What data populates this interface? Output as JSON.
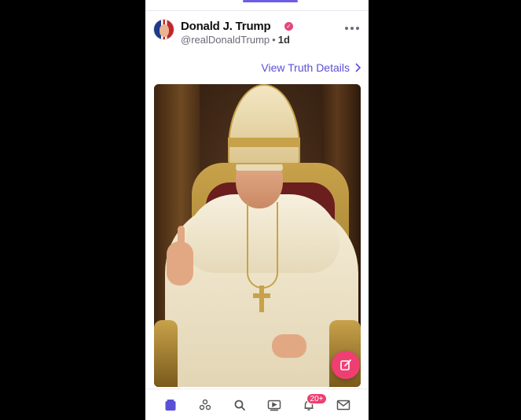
{
  "post": {
    "display_name": "Donald J. Trump",
    "handle": "@realDonaldTrump",
    "separator": "•",
    "time": "1d",
    "view_details": "View Truth Details"
  },
  "nav": {
    "notifications_badge": "20+"
  },
  "colors": {
    "accent": "#5b4fd6",
    "compose": "#ef3f72",
    "verified": "#e8457a"
  },
  "icons": [
    "verified-icon",
    "more-icon",
    "chevron-right-icon",
    "compose-icon",
    "home-icon",
    "groups-icon",
    "search-icon",
    "video-icon",
    "bell-icon",
    "mail-icon"
  ]
}
